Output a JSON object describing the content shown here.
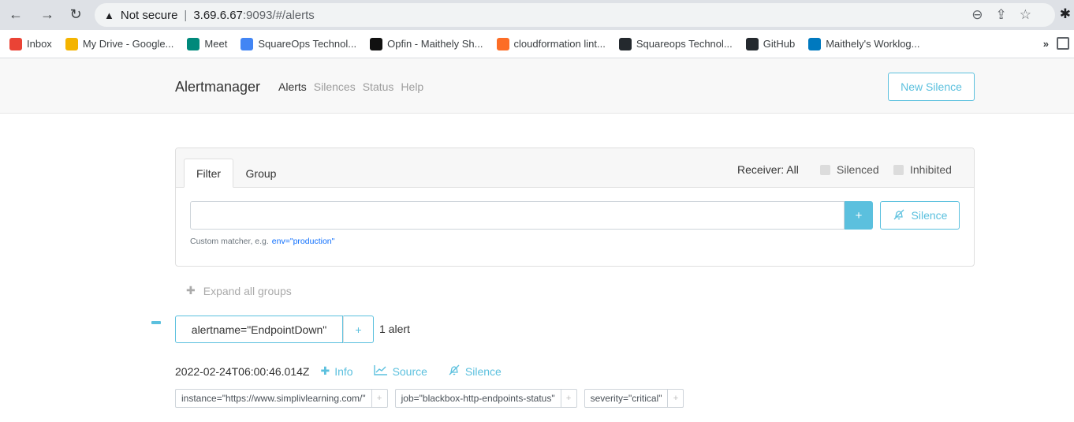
{
  "browser": {
    "url_warning": "Not secure",
    "url_host": "3.69.6.67",
    "url_path": ":9093/#/alerts",
    "bookmarks": [
      {
        "label": "Inbox",
        "icon": "gmail-icon",
        "color": "#ea4335"
      },
      {
        "label": "My Drive - Google...",
        "icon": "drive-icon",
        "color": "#f4b400"
      },
      {
        "label": "Meet",
        "icon": "meet-icon",
        "color": "#00897b"
      },
      {
        "label": "SquareOps Technol...",
        "icon": "calendar-icon",
        "color": "#4285f4"
      },
      {
        "label": "Opfin - Maithely Sh...",
        "icon": "x-icon",
        "color": "#111111"
      },
      {
        "label": "cloudformation lint...",
        "icon": "gitlab-icon",
        "color": "#fc6d26"
      },
      {
        "label": "Squareops Technol...",
        "icon": "github-icon",
        "color": "#24292e"
      },
      {
        "label": "GitHub",
        "icon": "github-icon",
        "color": "#24292e"
      },
      {
        "label": "Maithely's Worklog...",
        "icon": "trello-icon",
        "color": "#0079bf"
      }
    ],
    "more": "»"
  },
  "nav": {
    "brand": "Alertmanager",
    "links": [
      "Alerts",
      "Silences",
      "Status",
      "Help"
    ],
    "new_silence": "New Silence"
  },
  "filter": {
    "tabs": [
      "Filter",
      "Group"
    ],
    "receiver": "Receiver: All",
    "silenced": "Silenced",
    "inhibited": "Inhibited",
    "plus": "+",
    "silence_btn": "Silence",
    "hint": "Custom matcher, e.g.",
    "hint_code": "env=\"production\""
  },
  "expand_all": "Expand all groups",
  "group": {
    "label": "alertname=\"EndpointDown\"",
    "plus": "+",
    "count": "1 alert"
  },
  "alert": {
    "time": "2022-02-24T06:00:46.014Z",
    "info": "Info",
    "source": "Source",
    "silence": "Silence",
    "labels": [
      "instance=\"https://www.simplivlearning.com/\"",
      "job=\"blackbox-http-endpoints-status\"",
      "severity=\"critical\""
    ],
    "label_plus": "+"
  },
  "colors": {
    "accent": "#5bc0de"
  }
}
